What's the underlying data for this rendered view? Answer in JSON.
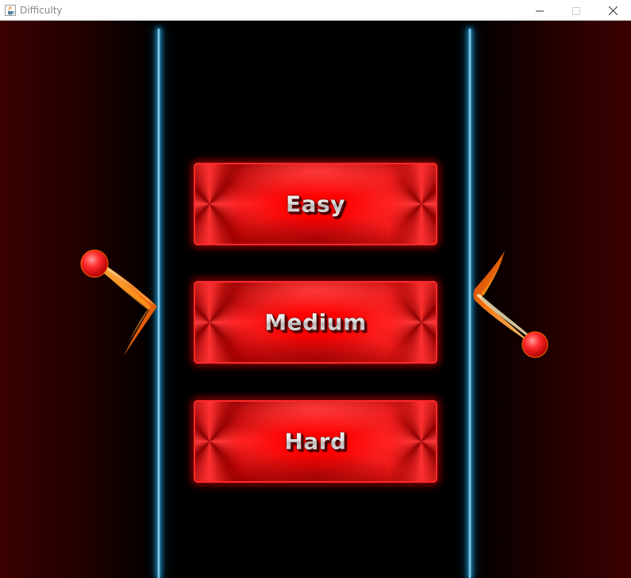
{
  "window": {
    "title": "Difficulty",
    "icon": "java-cup-icon",
    "controls": [
      "minimize-icon",
      "maximize-icon",
      "close-icon"
    ]
  },
  "game": {
    "difficulty_options": [
      {
        "label": "Easy"
      },
      {
        "label": "Medium"
      },
      {
        "label": "Hard"
      }
    ]
  },
  "colors": {
    "button_red": "#ff0000",
    "neon_blue": "#5ec8f2",
    "side_dark_red": "#3a0000",
    "background": "#000000"
  }
}
